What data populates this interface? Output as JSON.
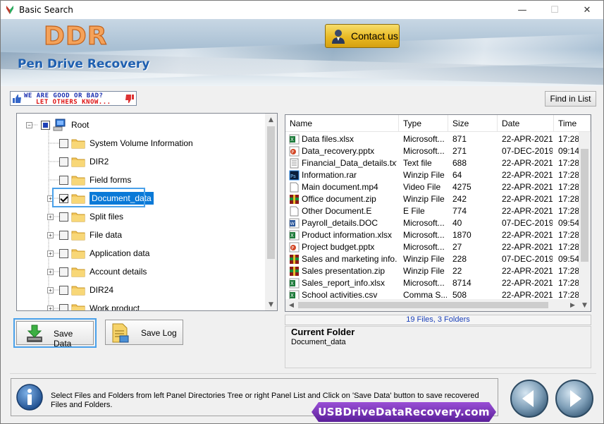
{
  "window": {
    "title": "Basic Search",
    "minimize": "—",
    "maximize": "☐",
    "close": "✕"
  },
  "banner": {
    "logo": "DDR",
    "product": "Pen Drive Recovery",
    "contact_label": "Contact us"
  },
  "feedback": {
    "line1": "WE ARE GOOD OR BAD?",
    "line2": "LET OTHERS KNOW..."
  },
  "find_label": "Find in List",
  "tree": {
    "root": "Root",
    "items": [
      {
        "label": "System Volume Information",
        "expandable": false,
        "checked": false
      },
      {
        "label": "DIR2",
        "expandable": false,
        "checked": false
      },
      {
        "label": "Field forms",
        "expandable": false,
        "checked": false
      },
      {
        "label": "Document_data",
        "expandable": true,
        "checked": true,
        "selected": true
      },
      {
        "label": "Split files",
        "expandable": true,
        "checked": false
      },
      {
        "label": "File data",
        "expandable": true,
        "checked": false
      },
      {
        "label": "Application data",
        "expandable": true,
        "checked": false
      },
      {
        "label": "Account details",
        "expandable": true,
        "checked": false
      },
      {
        "label": "DIR24",
        "expandable": true,
        "checked": false
      },
      {
        "label": "Work product",
        "expandable": true,
        "checked": false
      }
    ]
  },
  "list": {
    "columns": [
      "Name",
      "Type",
      "Size",
      "Date",
      "Time"
    ],
    "rows": [
      {
        "icon": "excel",
        "name": "Data files.xlsx",
        "type": "Microsoft...",
        "size": "871",
        "date": "22-APR-2021",
        "time": "17:28"
      },
      {
        "icon": "powerpoint",
        "name": "Data_recovery.pptx",
        "type": "Microsoft...",
        "size": "271",
        "date": "07-DEC-2019",
        "time": "09:14"
      },
      {
        "icon": "text",
        "name": "Financial_Data_details.txt",
        "type": "Text file",
        "size": "688",
        "date": "22-APR-2021",
        "time": "17:28"
      },
      {
        "icon": "photoshop",
        "name": "Information.rar",
        "type": "Winzip File",
        "size": "64",
        "date": "22-APR-2021",
        "time": "17:28"
      },
      {
        "icon": "blank",
        "name": "Main document.mp4",
        "type": "Video File",
        "size": "4275",
        "date": "22-APR-2021",
        "time": "17:28"
      },
      {
        "icon": "zip",
        "name": "Office document.zip",
        "type": "Winzip File",
        "size": "242",
        "date": "22-APR-2021",
        "time": "17:28"
      },
      {
        "icon": "blank",
        "name": "Other Document.E",
        "type": "E File",
        "size": "774",
        "date": "22-APR-2021",
        "time": "17:28"
      },
      {
        "icon": "word",
        "name": "Payroll_details.DOC",
        "type": "Microsoft...",
        "size": "40",
        "date": "07-DEC-2019",
        "time": "09:54"
      },
      {
        "icon": "excel",
        "name": "Product information.xlsx",
        "type": "Microsoft...",
        "size": "1870",
        "date": "22-APR-2021",
        "time": "17:28"
      },
      {
        "icon": "powerpoint",
        "name": "Project budget.pptx",
        "type": "Microsoft...",
        "size": "27",
        "date": "22-APR-2021",
        "time": "17:28"
      },
      {
        "icon": "zip",
        "name": "Sales and marketing info.zip",
        "type": "Winzip File",
        "size": "228",
        "date": "07-DEC-2019",
        "time": "09:54"
      },
      {
        "icon": "zip",
        "name": "Sales presentation.zip",
        "type": "Winzip File",
        "size": "22",
        "date": "22-APR-2021",
        "time": "17:28"
      },
      {
        "icon": "excel",
        "name": "Sales_report_info.xlsx",
        "type": "Microsoft...",
        "size": "8714",
        "date": "22-APR-2021",
        "time": "17:28"
      },
      {
        "icon": "excel",
        "name": "School activities.csv",
        "type": "Comma S...",
        "size": "508",
        "date": "22-APR-2021",
        "time": "17:28"
      }
    ]
  },
  "count_text": "19 Files, 3 Folders",
  "current_folder": {
    "title": "Current Folder",
    "value": "Document_data"
  },
  "buttons": {
    "save_data": "Save Data",
    "save_log": "Save Log"
  },
  "info_text": "Select Files and Folders from left Panel Directories Tree or right Panel List and Click on 'Save Data' button to save recovered Files and Folders.",
  "site": "USBDriveDataRecovery.com",
  "colors": {
    "selection": "#0a79d7",
    "focus": "#4aa1ea",
    "count_text": "#1a3fb8",
    "product_blue": "#1e5fb0",
    "logo_orange": "#f4a25a"
  }
}
